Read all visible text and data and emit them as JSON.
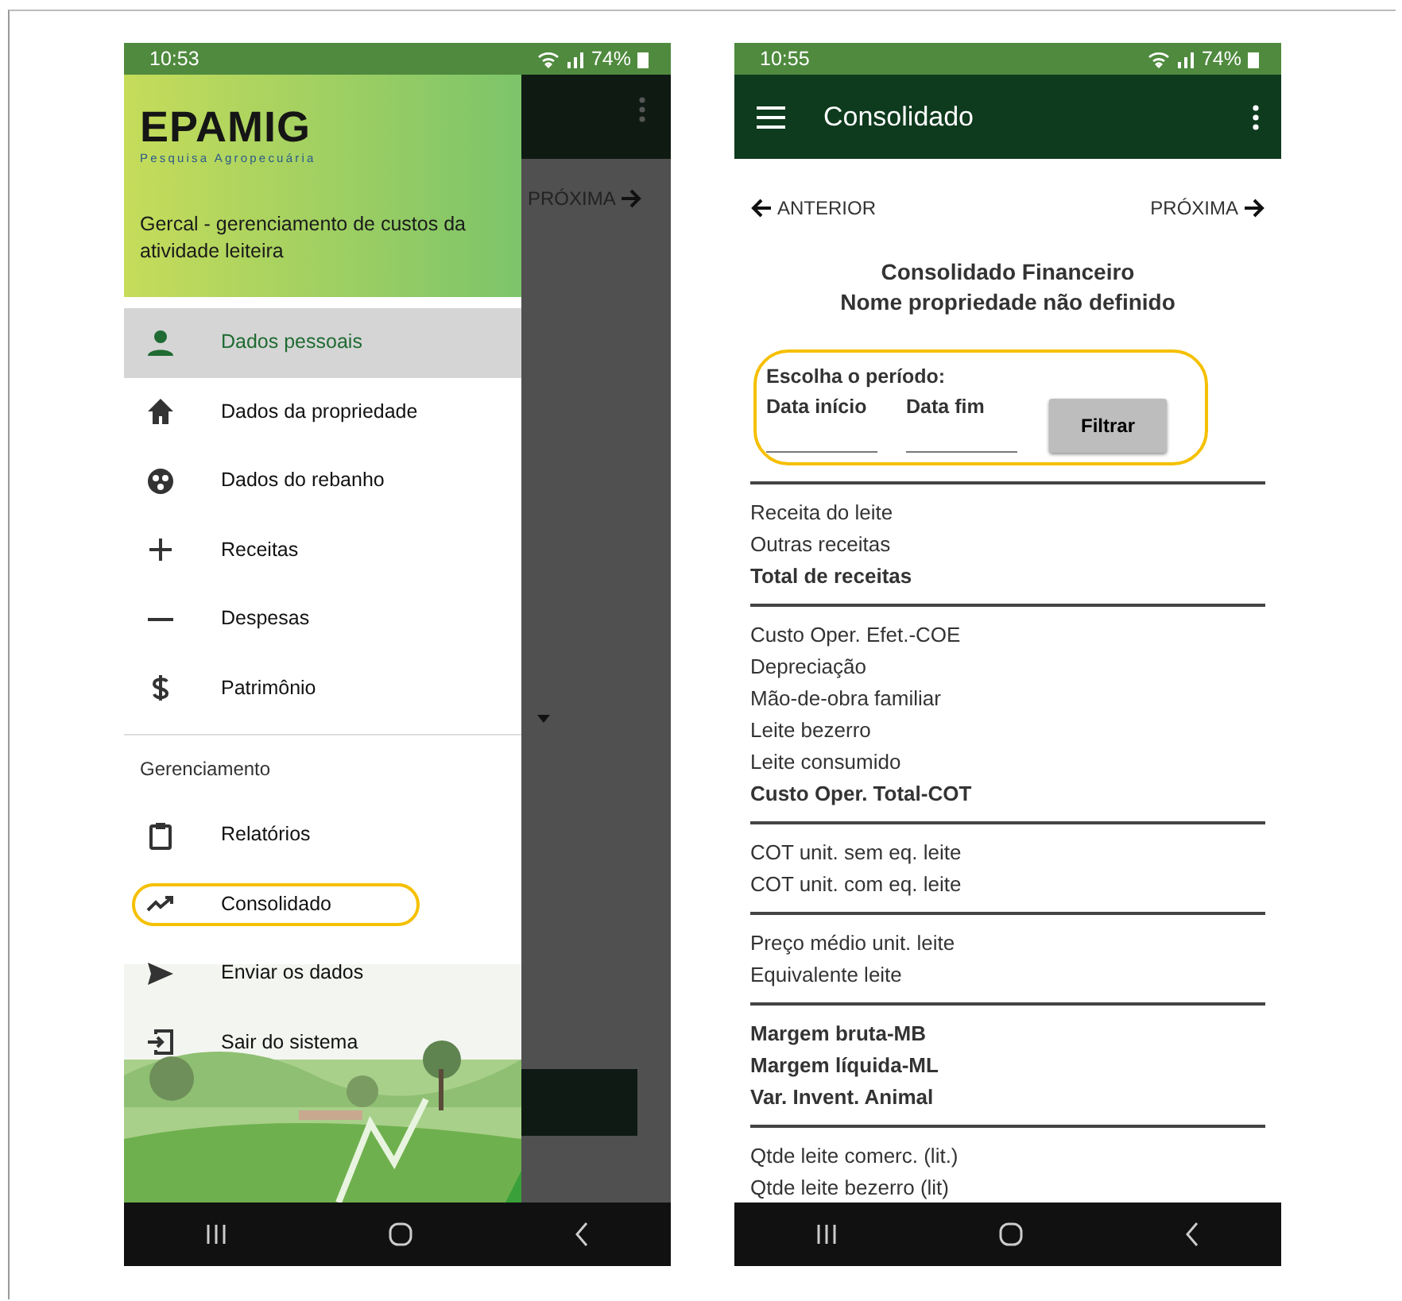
{
  "left_screen": {
    "status_bar": {
      "time": "10:53",
      "battery": "74%"
    },
    "drawer": {
      "logo": {
        "name": "EPAMIG",
        "tagline": "Pesquisa Agropecuária"
      },
      "subtitle": "Gercal - gerenciamento de custos da atividade leiteira",
      "items": [
        {
          "label": "Dados pessoais",
          "kind": "person",
          "selected": true,
          "highlighted": false
        },
        {
          "label": "Dados da propriedade",
          "kind": "home",
          "selected": false,
          "highlighted": false
        },
        {
          "label": "Dados do rebanho",
          "kind": "herd",
          "selected": false,
          "highlighted": false
        },
        {
          "label": "Receitas",
          "kind": "plus",
          "selected": false,
          "highlighted": false
        },
        {
          "label": "Despesas",
          "kind": "minus",
          "selected": false,
          "highlighted": false
        },
        {
          "label": "Patrimônio",
          "kind": "dollar",
          "selected": false,
          "highlighted": false
        }
      ],
      "section_title": "Gerenciamento",
      "section_items": [
        {
          "label": "Relatórios",
          "kind": "clipboard",
          "selected": false,
          "highlighted": false
        },
        {
          "label": "Consolidado",
          "kind": "trend",
          "selected": false,
          "highlighted": true
        },
        {
          "label": "Enviar os dados",
          "kind": "send",
          "selected": false,
          "highlighted": false
        },
        {
          "label": "Sair do sistema",
          "kind": "exit",
          "selected": false,
          "highlighted": false
        }
      ]
    },
    "behind": {
      "next_link": "PRÓXIMA"
    }
  },
  "right_screen": {
    "status_bar": {
      "time": "10:55",
      "battery": "74%"
    },
    "toolbar": {
      "title": "Consolidado"
    },
    "nav": {
      "previous": "ANTERIOR",
      "next": "PRÓXIMA"
    },
    "heading": [
      "Consolidado Financeiro",
      "Nome propriedade não definido"
    ],
    "period": {
      "title": "Escolha o período:",
      "start_label": "Data início",
      "end_label": "Data fim",
      "button": "Filtrar",
      "highlighted": true
    },
    "groups": [
      {
        "rows": [
          {
            "label": "Receita do leite",
            "bold": false
          },
          {
            "label": "Outras receitas",
            "bold": false
          },
          {
            "label": "Total de receitas",
            "bold": true
          }
        ]
      },
      {
        "rows": [
          {
            "label": "Custo Oper. Efet.-COE",
            "bold": false
          },
          {
            "label": "Depreciação",
            "bold": false
          },
          {
            "label": "Mão-de-obra familiar",
            "bold": false
          },
          {
            "label": "Leite bezerro",
            "bold": false
          },
          {
            "label": "Leite consumido",
            "bold": false
          },
          {
            "label": "Custo Oper. Total-COT",
            "bold": true
          }
        ]
      },
      {
        "rows": [
          {
            "label": "COT unit. sem eq. leite",
            "bold": false
          },
          {
            "label": "COT unit. com eq. leite",
            "bold": false
          }
        ]
      },
      {
        "rows": [
          {
            "label": "Preço médio unit. leite",
            "bold": false
          },
          {
            "label": "Equivalente leite",
            "bold": false
          }
        ]
      },
      {
        "rows": [
          {
            "label": "Margem bruta-MB",
            "bold": true
          },
          {
            "label": "Margem líquida-ML",
            "bold": true
          },
          {
            "label": "Var. Invent. Animal",
            "bold": true
          }
        ]
      },
      {
        "rows": [
          {
            "label": "Qtde leite comerc. (lit.)",
            "bold": false
          },
          {
            "label": "Qtde leite bezerro (lit)",
            "bold": false
          }
        ]
      }
    ]
  }
}
